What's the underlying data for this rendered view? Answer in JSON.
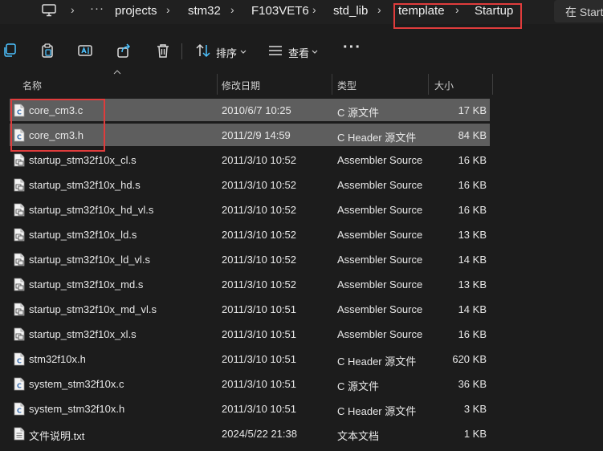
{
  "breadcrumbs": [
    {
      "label": "projects"
    },
    {
      "label": "stm32"
    },
    {
      "label": "F103VET6"
    },
    {
      "label": "std_lib"
    },
    {
      "label": "template"
    },
    {
      "label": "Startup"
    }
  ],
  "address_ellipsis": "···",
  "search_placeholder": "在 Startup",
  "toolbar": {
    "sort_label": "排序",
    "view_label": "查看",
    "more_label": "···"
  },
  "columns": {
    "name": "名称",
    "date": "修改日期",
    "type": "类型",
    "size": "大小"
  },
  "colors": {
    "accent_highlight": "#e03c3c",
    "selection_bg": "#5e5e5e",
    "window_bg": "#1c1c1c"
  },
  "files": [
    {
      "name": "core_cm3.c",
      "date": "2010/6/7 10:25",
      "type": "C 源文件",
      "size": "17 KB",
      "icon": "c-source-file-icon",
      "selected": true
    },
    {
      "name": "core_cm3.h",
      "date": "2011/2/9 14:59",
      "type": "C Header 源文件",
      "size": "84 KB",
      "icon": "c-header-file-icon",
      "selected": true
    },
    {
      "name": "startup_stm32f10x_cl.s",
      "date": "2011/3/10 10:52",
      "type": "Assembler Source",
      "size": "16 KB",
      "icon": "assembler-file-icon",
      "selected": false
    },
    {
      "name": "startup_stm32f10x_hd.s",
      "date": "2011/3/10 10:52",
      "type": "Assembler Source",
      "size": "16 KB",
      "icon": "assembler-file-icon",
      "selected": false
    },
    {
      "name": "startup_stm32f10x_hd_vl.s",
      "date": "2011/3/10 10:52",
      "type": "Assembler Source",
      "size": "16 KB",
      "icon": "assembler-file-icon",
      "selected": false
    },
    {
      "name": "startup_stm32f10x_ld.s",
      "date": "2011/3/10 10:52",
      "type": "Assembler Source",
      "size": "13 KB",
      "icon": "assembler-file-icon",
      "selected": false
    },
    {
      "name": "startup_stm32f10x_ld_vl.s",
      "date": "2011/3/10 10:52",
      "type": "Assembler Source",
      "size": "14 KB",
      "icon": "assembler-file-icon",
      "selected": false
    },
    {
      "name": "startup_stm32f10x_md.s",
      "date": "2011/3/10 10:52",
      "type": "Assembler Source",
      "size": "13 KB",
      "icon": "assembler-file-icon",
      "selected": false
    },
    {
      "name": "startup_stm32f10x_md_vl.s",
      "date": "2011/3/10 10:51",
      "type": "Assembler Source",
      "size": "14 KB",
      "icon": "assembler-file-icon",
      "selected": false
    },
    {
      "name": "startup_stm32f10x_xl.s",
      "date": "2011/3/10 10:51",
      "type": "Assembler Source",
      "size": "16 KB",
      "icon": "assembler-file-icon",
      "selected": false
    },
    {
      "name": "stm32f10x.h",
      "date": "2011/3/10 10:51",
      "type": "C Header 源文件",
      "size": "620 KB",
      "icon": "c-header-file-icon",
      "selected": false
    },
    {
      "name": "system_stm32f10x.c",
      "date": "2011/3/10 10:51",
      "type": "C 源文件",
      "size": "36 KB",
      "icon": "c-source-file-icon",
      "selected": false
    },
    {
      "name": "system_stm32f10x.h",
      "date": "2011/3/10 10:51",
      "type": "C Header 源文件",
      "size": "3 KB",
      "icon": "c-header-file-icon",
      "selected": false
    },
    {
      "name": "文件说明.txt",
      "date": "2024/5/22 21:38",
      "type": "文本文档",
      "size": "1 KB",
      "icon": "text-file-icon",
      "selected": false
    }
  ]
}
